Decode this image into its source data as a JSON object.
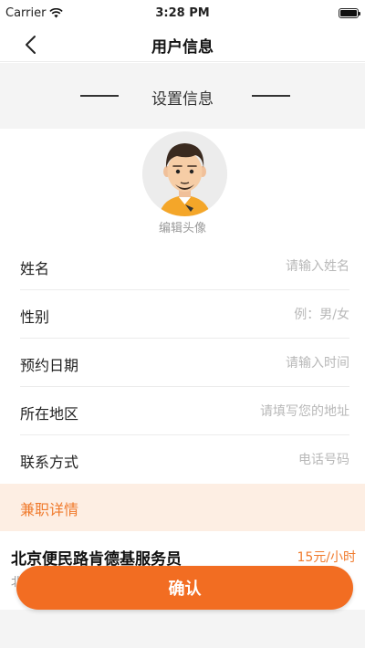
{
  "status_bar": {
    "carrier": "Carrier",
    "time": "3:28 PM",
    "wifi_icon": "wifi-icon",
    "battery_icon": "battery-icon"
  },
  "nav": {
    "title": "用户信息",
    "back_icon": "chevron-left-icon"
  },
  "section": {
    "title": "设置信息"
  },
  "avatar": {
    "caption": "编辑头像",
    "icon": "user-avatar-icon"
  },
  "form": {
    "fields": [
      {
        "label": "姓名",
        "placeholder": "请输入姓名",
        "value": ""
      },
      {
        "label": "性别",
        "placeholder": "例：男/女",
        "value": ""
      },
      {
        "label": "预约日期",
        "placeholder": "请输入时间",
        "value": ""
      },
      {
        "label": "所在地区",
        "placeholder": "请填写您的地址",
        "value": ""
      },
      {
        "label": "联系方式",
        "placeholder": "电话号码",
        "value": ""
      }
    ]
  },
  "detail": {
    "header": "兼职详情",
    "job_title": "北京便民路肯德基服务员",
    "job_price": "15元/小时",
    "job_sub": "北"
  },
  "actions": {
    "confirm_label": "确认"
  },
  "colors": {
    "accent": "#f26d22",
    "accent_text": "#f07a2c",
    "detail_bg": "#fdeee3",
    "section_bg": "#f4f4f4"
  }
}
